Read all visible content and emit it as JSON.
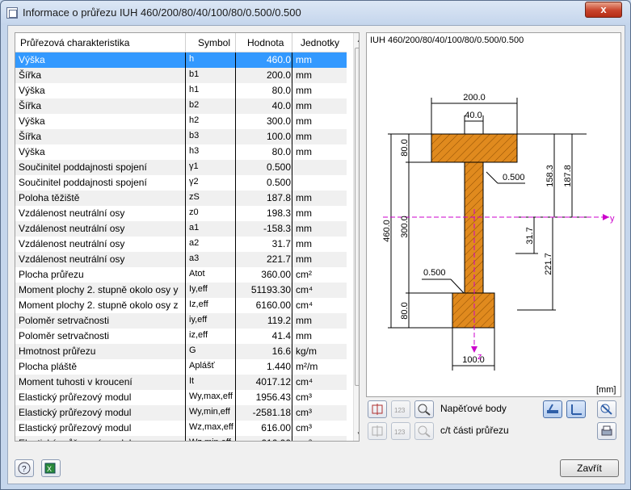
{
  "window": {
    "title": "Informace o průřezu IUH 460/200/80/40/100/80/0.500/0.500",
    "close_symbol": "x"
  },
  "table": {
    "headers": {
      "name": "Průřezová charakteristika",
      "symbol": "Symbol",
      "value": "Hodnota",
      "units": "Jednotky"
    },
    "rows": [
      {
        "name": "Výška",
        "symbol": "h",
        "value": "460.0",
        "unit": "mm"
      },
      {
        "name": "Šířka",
        "symbol": "b1",
        "value": "200.0",
        "unit": "mm"
      },
      {
        "name": "Výška",
        "symbol": "h1",
        "value": "80.0",
        "unit": "mm"
      },
      {
        "name": "Šířka",
        "symbol": "b2",
        "value": "40.0",
        "unit": "mm"
      },
      {
        "name": "Výška",
        "symbol": "h2",
        "value": "300.0",
        "unit": "mm"
      },
      {
        "name": "Šířka",
        "symbol": "b3",
        "value": "100.0",
        "unit": "mm"
      },
      {
        "name": "Výška",
        "symbol": "h3",
        "value": "80.0",
        "unit": "mm"
      },
      {
        "name": "Součinitel poddajnosti spojení",
        "symbol": "γ1",
        "value": "0.500",
        "unit": ""
      },
      {
        "name": "Součinitel poddajnosti spojení",
        "symbol": "γ2",
        "value": "0.500",
        "unit": ""
      },
      {
        "name": "Poloha těžiště",
        "symbol": "zS",
        "value": "187.8",
        "unit": "mm"
      },
      {
        "name": "Vzdálenost neutrální osy",
        "symbol": "z0",
        "value": "198.3",
        "unit": "mm"
      },
      {
        "name": "Vzdálenost neutrální osy",
        "symbol": "a1",
        "value": "-158.3",
        "unit": "mm"
      },
      {
        "name": "Vzdálenost neutrální osy",
        "symbol": "a2",
        "value": "31.7",
        "unit": "mm"
      },
      {
        "name": "Vzdálenost neutrální osy",
        "symbol": "a3",
        "value": "221.7",
        "unit": "mm"
      },
      {
        "name": "Plocha průřezu",
        "symbol": "Atot",
        "value": "360.00",
        "unit": "cm²"
      },
      {
        "name": "Moment plochy 2. stupně okolo osy y",
        "symbol": "Iy,eff",
        "value": "51193.30",
        "unit": "cm⁴"
      },
      {
        "name": "Moment plochy 2. stupně okolo osy z",
        "symbol": "Iz,eff",
        "value": "6160.00",
        "unit": "cm⁴"
      },
      {
        "name": "Poloměr setrvačnosti",
        "symbol": "iy,eff",
        "value": "119.2",
        "unit": "mm"
      },
      {
        "name": "Poloměr setrvačnosti",
        "symbol": "iz,eff",
        "value": "41.4",
        "unit": "mm"
      },
      {
        "name": "Hmotnost průřezu",
        "symbol": "G",
        "value": "16.6",
        "unit": "kg/m"
      },
      {
        "name": "Plocha pláště",
        "symbol": "Aplášť",
        "value": "1.440",
        "unit": "m²/m"
      },
      {
        "name": "Moment tuhosti v kroucení",
        "symbol": "It",
        "value": "4017.12",
        "unit": "cm⁴"
      },
      {
        "name": "Elastický průřezový modul",
        "symbol": "Wy,max,eff",
        "value": "1956.43",
        "unit": "cm³"
      },
      {
        "name": "Elastický průřezový modul",
        "symbol": "Wy,min,eff",
        "value": "-2581.18",
        "unit": "cm³"
      },
      {
        "name": "Elastický průřezový modul",
        "symbol": "Wz,max,eff",
        "value": "616.00",
        "unit": "cm³"
      },
      {
        "name": "Elastický průřezový modul",
        "symbol": "Wz,min,eff",
        "value": "-616.00",
        "unit": "cm³"
      }
    ]
  },
  "drawing": {
    "title": "IUH 460/200/80/40/100/80/0.500/0.500",
    "units": "[mm]",
    "dims": {
      "top_width": "200.0",
      "web_width": "40.0",
      "bottom_width": "100.0",
      "total_height": "460.0",
      "top_flange_h": "80.0",
      "web_h": "300.0",
      "bottom_flange_h": "80.0",
      "a1": "158.3",
      "z0": "198.3",
      "zs": "187.8",
      "a2": "31.7",
      "a3": "221.7",
      "gamma1": "0.500",
      "gamma2": "0.500"
    },
    "axis_y": "y",
    "axis_z": "z",
    "colors": {
      "fill": "#e08a1e",
      "hatch": "#8a4a00",
      "axis": "#cc00cc"
    }
  },
  "tools": {
    "stress_points_label": "Napěťové body",
    "ct_label": "c/t části průřezu"
  },
  "footer": {
    "close_label": "Zavřít"
  }
}
